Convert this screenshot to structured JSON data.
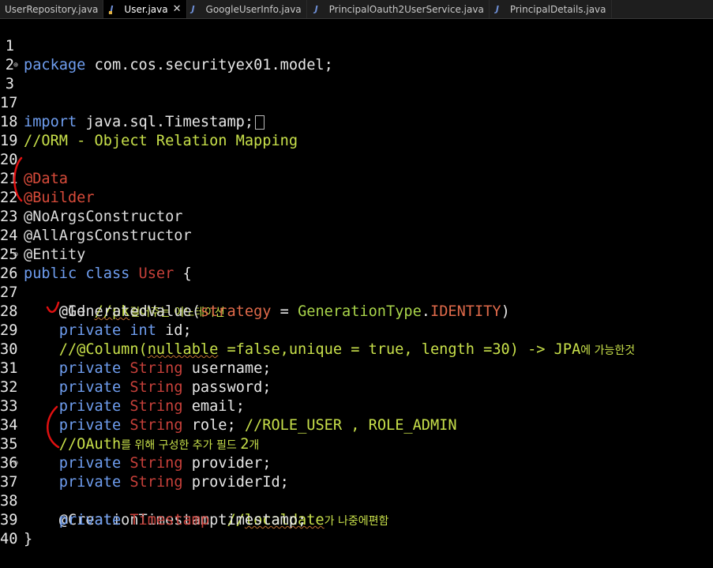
{
  "tabs": [
    {
      "label": "UserRepository.java",
      "active": false
    },
    {
      "label": "User.java",
      "active": true
    },
    {
      "label": "GoogleUserInfo.java",
      "active": false
    },
    {
      "label": "PrincipalOauth2UserService.java",
      "active": false
    },
    {
      "label": "PrincipalDetails.java",
      "active": false
    }
  ],
  "line_numbers": [
    "1",
    "2",
    "3",
    "17",
    "18",
    "19",
    "20",
    "21",
    "22",
    "23",
    "24",
    "25",
    "26",
    "27",
    "28",
    "29",
    "30",
    "31",
    "32",
    "33",
    "34",
    "35",
    "36",
    "37",
    "38",
    "39",
    "40"
  ],
  "code": {
    "l1_kw": "package",
    "l1_rest": " com.cos.securityex01.model;",
    "l3_kw": "import",
    "l3_rest": " java.sql.Timestamp;",
    "l18_comment": "//ORM - Object Relation Mapping",
    "l20": "@Data",
    "l21": "@Builder",
    "l22": "@NoArgsConstructor",
    "l23": "@AllArgsConstructor",
    "l24": "@Entity",
    "l25_kw": "public class",
    "l25_type": "User",
    "l25_brace": " {",
    "l26_ann": "@Id",
    "l26_cm": "//pk",
    "l26_kr": "걸어주는 어노테이션",
    "l27_ann": "@GeneratedValue(",
    "l27_param": "strategy",
    "l27_eq": " = ",
    "l27_class": "GenerationType",
    "l27_dot": ".",
    "l27_const": "IDENTITY",
    "l27_close": ")",
    "l28_kw": "private int",
    "l28_rest": " id;",
    "l29_cm_a": "//@Column(",
    "l29_cm_b": "nullable",
    "l29_cm_c": " =false,unique = true, length =30) -> JPA",
    "l29_kr": "에 가능한것",
    "l30_name": " username;",
    "l31_name": " password;",
    "l32_name": " email;",
    "l33_name": " role;",
    "l33_cm": "//ROLE_USER , ROLE_ADMIN",
    "l34_cm": "//OAuth",
    "l34_kr": "를 위해 구성한 추가 필드 ",
    "l34_num": "2",
    "l34_kr2": "개",
    "l35_name": " provider;",
    "l36_name": " providerId;",
    "l37_ann": "@CreationTimestamp",
    "l37_cm_a": "//",
    "l37_cm_b": "localdate",
    "l37_kr": "가 나중에편함",
    "l38_type": "Timestamp",
    "l38_name": " timestamp;",
    "l39": "}",
    "private_kw": "private",
    "string_type": "String"
  },
  "colors": {
    "keyword": "#6f9ef0",
    "comment": "#c8e04a",
    "type": "#c7403a",
    "annotation": "#dcdcdc",
    "background": "#000000",
    "pen_marks": "#e01010"
  }
}
